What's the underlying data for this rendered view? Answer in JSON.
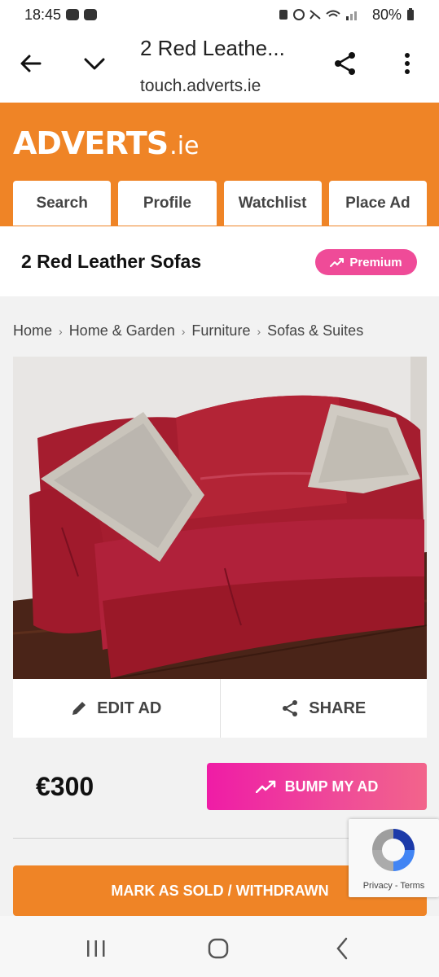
{
  "status_bar": {
    "time": "18:45",
    "battery": "80%"
  },
  "browser": {
    "title": "2 Red Leathe...",
    "url": "touch.adverts.ie"
  },
  "site": {
    "logo_main": "ADVERTS",
    "logo_suffix": ".ie",
    "nav": [
      {
        "label": "Search"
      },
      {
        "label": "Profile"
      },
      {
        "label": "Watchlist"
      },
      {
        "label": "Place Ad"
      }
    ]
  },
  "ad": {
    "title": "2 Red Leather Sofas",
    "badge": "Premium",
    "breadcrumb": [
      "Home",
      "Home & Garden",
      "Furniture",
      "Sofas & Suites"
    ],
    "price": "€300"
  },
  "actions": {
    "edit_label": "EDIT AD",
    "share_label": "SHARE",
    "bump_label": "BUMP MY AD",
    "mark_sold_label": "MARK AS SOLD / WITHDRAWN"
  },
  "recaptcha": {
    "links": "Privacy - Terms"
  },
  "colors": {
    "brand_orange": "#ef8426",
    "premium_pink": "#ef4b98",
    "bump_pink": "#ef1ca6"
  },
  "icons": [
    "back-arrow-icon",
    "chevron-down-icon",
    "share-icon",
    "more-vert-icon",
    "trending-up-icon",
    "pencil-icon",
    "recents-icon",
    "home-icon",
    "back-icon"
  ]
}
